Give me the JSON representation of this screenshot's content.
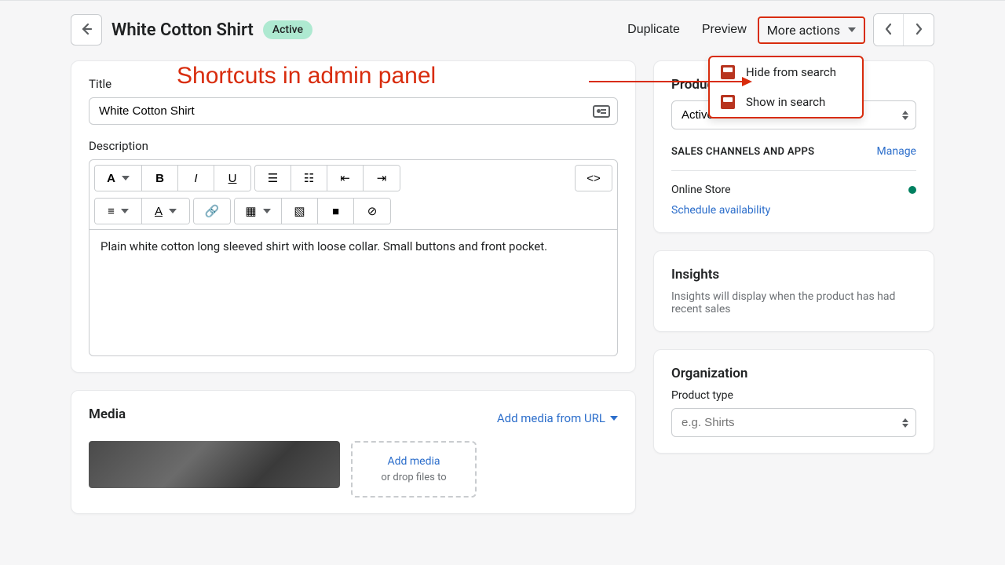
{
  "header": {
    "title": "White Cotton Shirt",
    "badge": "Active",
    "duplicate": "Duplicate",
    "preview": "Preview",
    "more_actions": "More actions"
  },
  "dropdown": {
    "hide": "Hide from search",
    "show": "Show in search"
  },
  "annotation": "Shortcuts in admin panel",
  "form": {
    "title_label": "Title",
    "title_value": "White Cotton Shirt",
    "description_label": "Description",
    "description_body": "Plain white cotton long sleeved shirt with loose collar. Small buttons and front pocket."
  },
  "media": {
    "heading": "Media",
    "add_url": "Add media from URL",
    "add_media": "Add media",
    "drop_sub": "or drop files to"
  },
  "sidebar": {
    "status_label": "Product sta",
    "status_value": "Active",
    "channels_heading": "SALES CHANNELS AND APPS",
    "manage": "Manage",
    "online_store": "Online Store",
    "schedule": "Schedule availability",
    "insights_heading": "Insights",
    "insights_body": "Insights will display when the product has had recent sales",
    "org_heading": "Organization",
    "product_type_label": "Product type",
    "product_type_placeholder": "e.g. Shirts"
  }
}
